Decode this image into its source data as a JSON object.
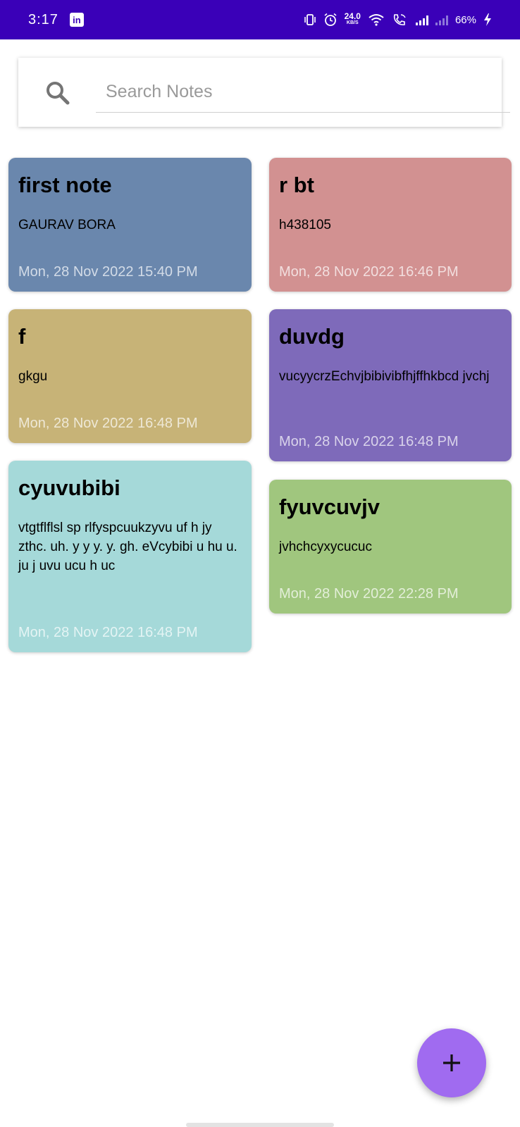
{
  "status_bar": {
    "time": "3:17",
    "app_badge": "in",
    "speed_value": "24.0",
    "speed_unit": "KB/S",
    "battery": "66%"
  },
  "search": {
    "placeholder": "Search Notes"
  },
  "notes": [
    {
      "title": "first note",
      "body": "GAURAV BORA",
      "date": "Mon, 28 Nov 2022 15:40 PM",
      "color": "#6a87ad"
    },
    {
      "title": "r bt",
      "body": "h438105",
      "date": "Mon, 28 Nov 2022 16:46 PM",
      "color": "#d29191"
    },
    {
      "title": "f",
      "body": "gkgu",
      "date": "Mon, 28 Nov 2022 16:48 PM",
      "color": "#c7b377"
    },
    {
      "title": "duvdg",
      "body": "vucyycrzEchvjbibivibfhjffhkbcd jvchj",
      "date": "Mon, 28 Nov 2022 16:48 PM",
      "color": "#7e6aba"
    },
    {
      "title": "cyuvubibi",
      "body": "vtgtflflsl sp rlfyspcuukzyvu uf h jy zthc. uh. y y y. y. gh. eVcybibi u hu u. ju j uvu ucu h uc",
      "date": "Mon, 28 Nov 2022 16:48 PM",
      "color": "#a5d9d9"
    },
    {
      "title": "fyuvcuvjv",
      "body": "jvhchcyxycucuc",
      "date": "Mon, 28 Nov 2022 22:28 PM",
      "color": "#a0c67e"
    }
  ],
  "fab": {
    "label": "+"
  }
}
